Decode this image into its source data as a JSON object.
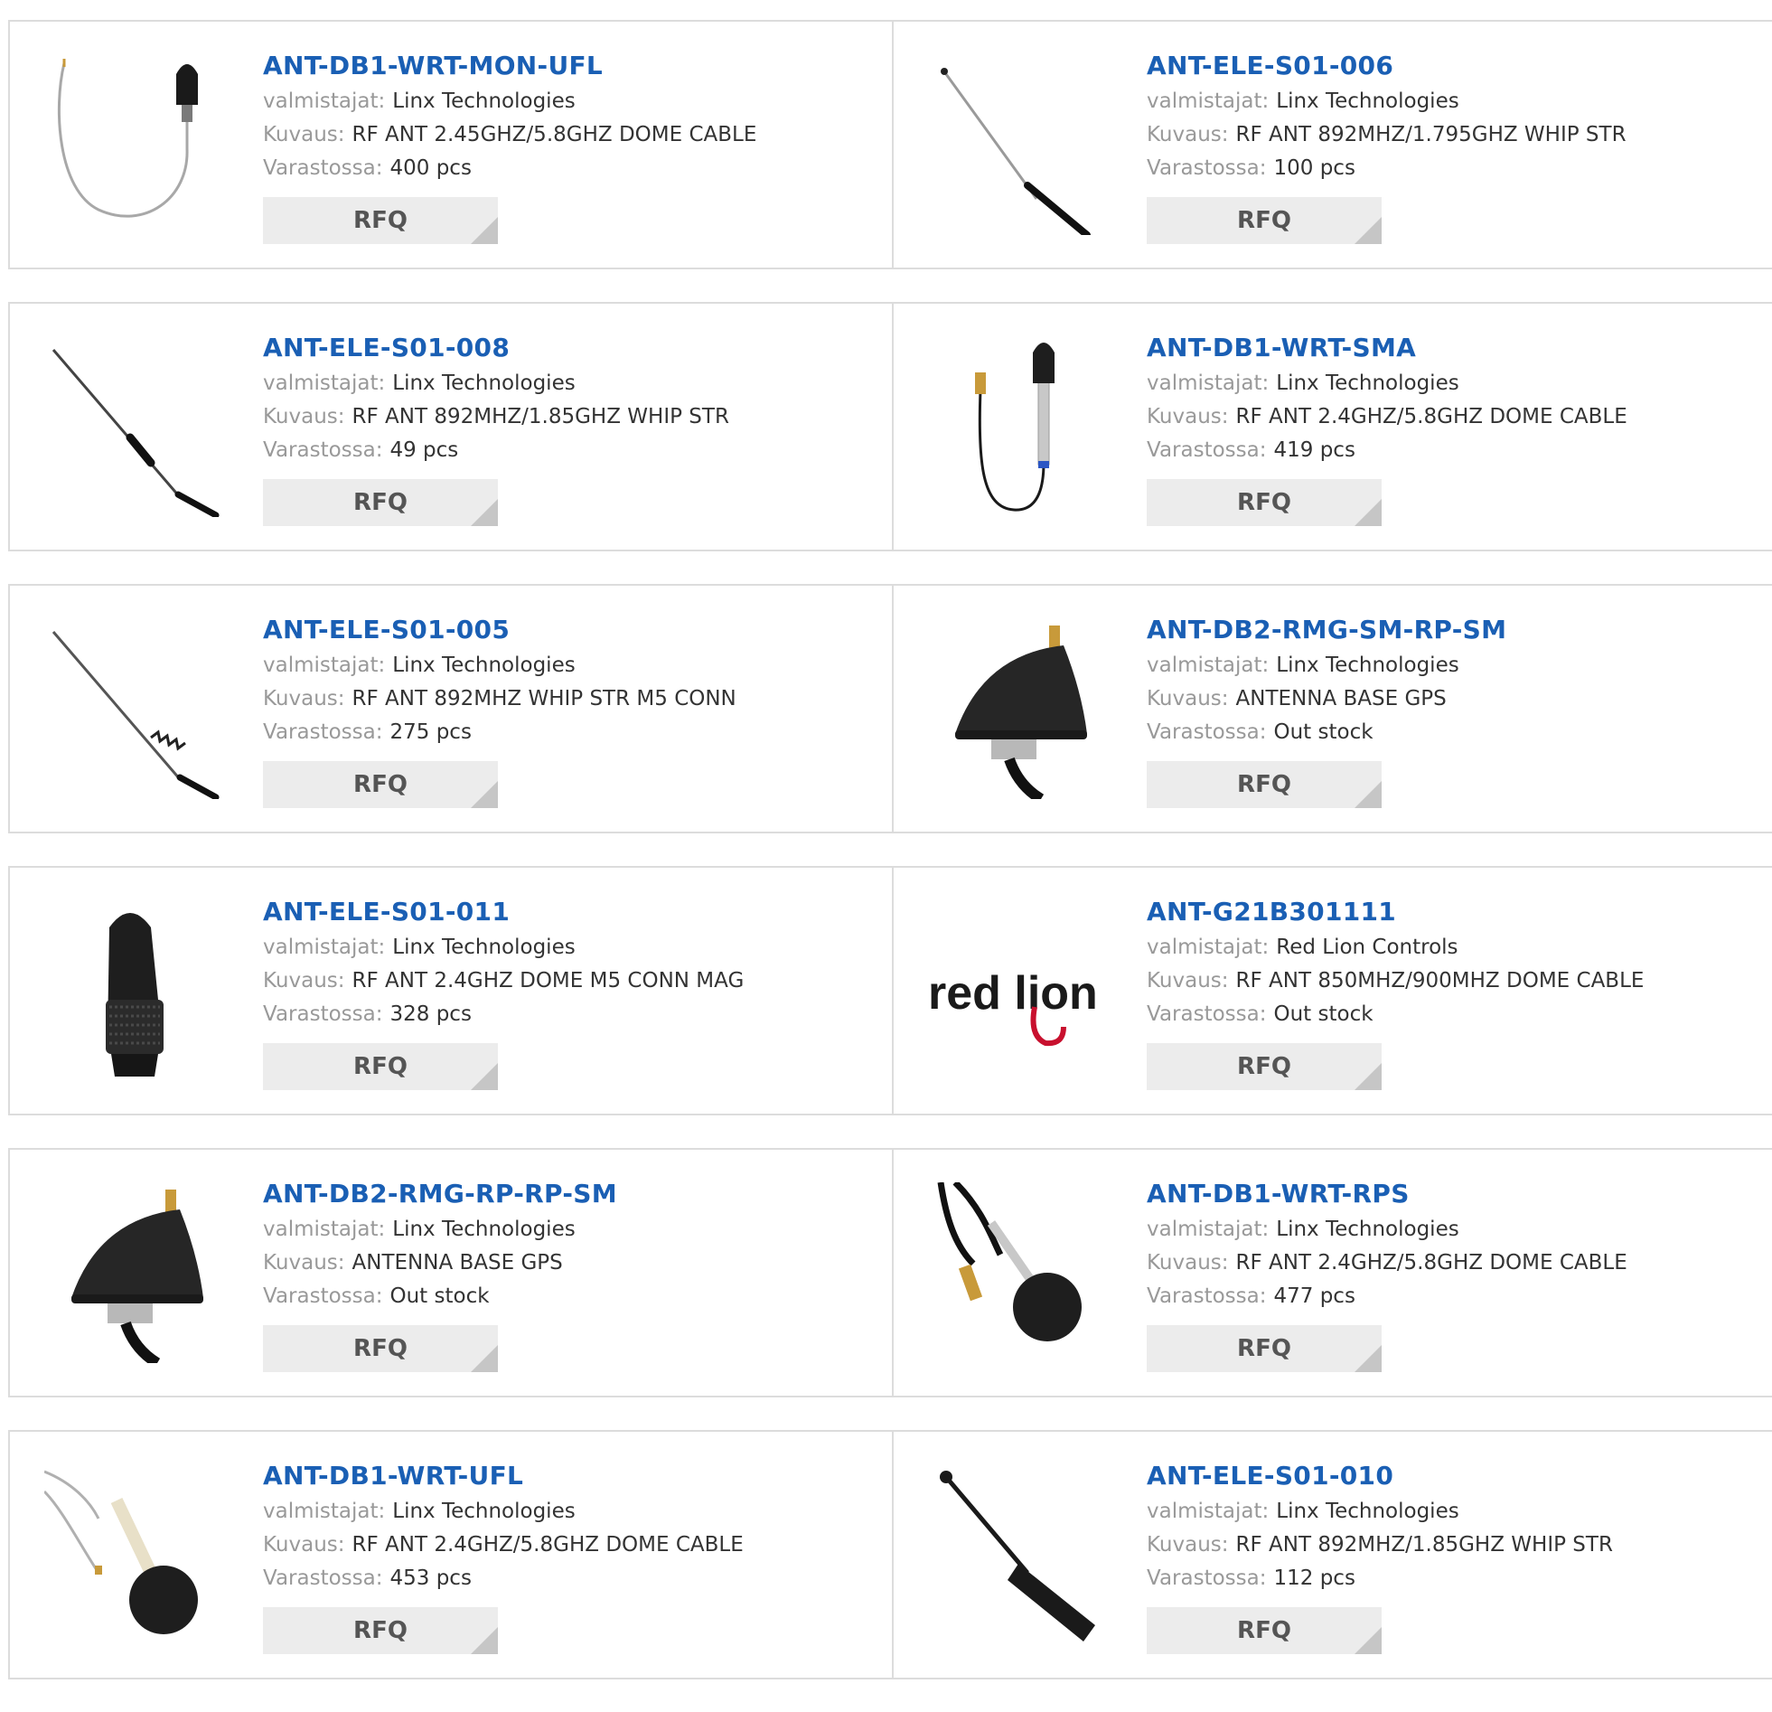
{
  "labels": {
    "manufacturer": "valmistajat:",
    "description": "Kuvaus:",
    "stock": "Varastossa:",
    "rfq": "RFQ"
  },
  "products": [
    {
      "part": "ANT-DB1-WRT-MON-UFL",
      "manufacturer": "Linx Technologies",
      "description": "RF ANT 2.45GHZ/5.8GHZ DOME CABLE",
      "stock": "400 pcs",
      "image": "dome-antenna-cable-image"
    },
    {
      "part": "ANT-ELE-S01-006",
      "manufacturer": "Linx Technologies",
      "description": "RF ANT 892MHZ/1.795GHZ WHIP STR",
      "stock": "100 pcs",
      "image": "whip-antenna-image"
    },
    {
      "part": "ANT-ELE-S01-008",
      "manufacturer": "Linx Technologies",
      "description": "RF ANT 892MHZ/1.85GHZ WHIP STR",
      "stock": "49 pcs",
      "image": "whip-antenna-image"
    },
    {
      "part": "ANT-DB1-WRT-SMA",
      "manufacturer": "Linx Technologies",
      "description": "RF ANT 2.4GHZ/5.8GHZ DOME CABLE",
      "stock": "419 pcs",
      "image": "dome-antenna-cable-image"
    },
    {
      "part": "ANT-ELE-S01-005",
      "manufacturer": "Linx Technologies",
      "description": "RF ANT 892MHZ WHIP STR M5 CONN",
      "stock": "275 pcs",
      "image": "whip-antenna-coil-image"
    },
    {
      "part": "ANT-DB2-RMG-SM-RP-SM",
      "manufacturer": "Linx Technologies",
      "description": "ANTENNA BASE GPS",
      "stock": "Out stock",
      "image": "antenna-base-image"
    },
    {
      "part": "ANT-ELE-S01-011",
      "manufacturer": "Linx Technologies",
      "description": "RF ANT 2.4GHZ DOME M5 CONN MAG",
      "stock": "328 pcs",
      "image": "stubby-antenna-image"
    },
    {
      "part": "ANT-G21B301111",
      "manufacturer": "Red Lion Controls",
      "description": "RF ANT 850MHZ/900MHZ DOME CABLE",
      "stock": "Out stock",
      "image": "red-lion-logo",
      "logo_text": "red lion"
    },
    {
      "part": "ANT-DB2-RMG-RP-RP-SM",
      "manufacturer": "Linx Technologies",
      "description": "ANTENNA BASE GPS",
      "stock": "Out stock",
      "image": "antenna-base-image"
    },
    {
      "part": "ANT-DB1-WRT-RPS",
      "manufacturer": "Linx Technologies",
      "description": "RF ANT 2.4GHZ/5.8GHZ DOME CABLE",
      "stock": "477 pcs",
      "image": "dome-antenna-cable-image"
    },
    {
      "part": "ANT-DB1-WRT-UFL",
      "manufacturer": "Linx Technologies",
      "description": "RF ANT 2.4GHZ/5.8GHZ DOME CABLE",
      "stock": "453 pcs",
      "image": "dome-antenna-cable-image"
    },
    {
      "part": "ANT-ELE-S01-010",
      "manufacturer": "Linx Technologies",
      "description": "RF ANT 892MHZ/1.85GHZ WHIP STR",
      "stock": "112 pcs",
      "image": "whip-antenna-image"
    }
  ],
  "colors": {
    "link": "#1a5fb4",
    "label": "#999999",
    "value": "#333333",
    "border": "#dcdcdc",
    "button_bg": "#ececec",
    "logo_red": "#c8102e"
  }
}
